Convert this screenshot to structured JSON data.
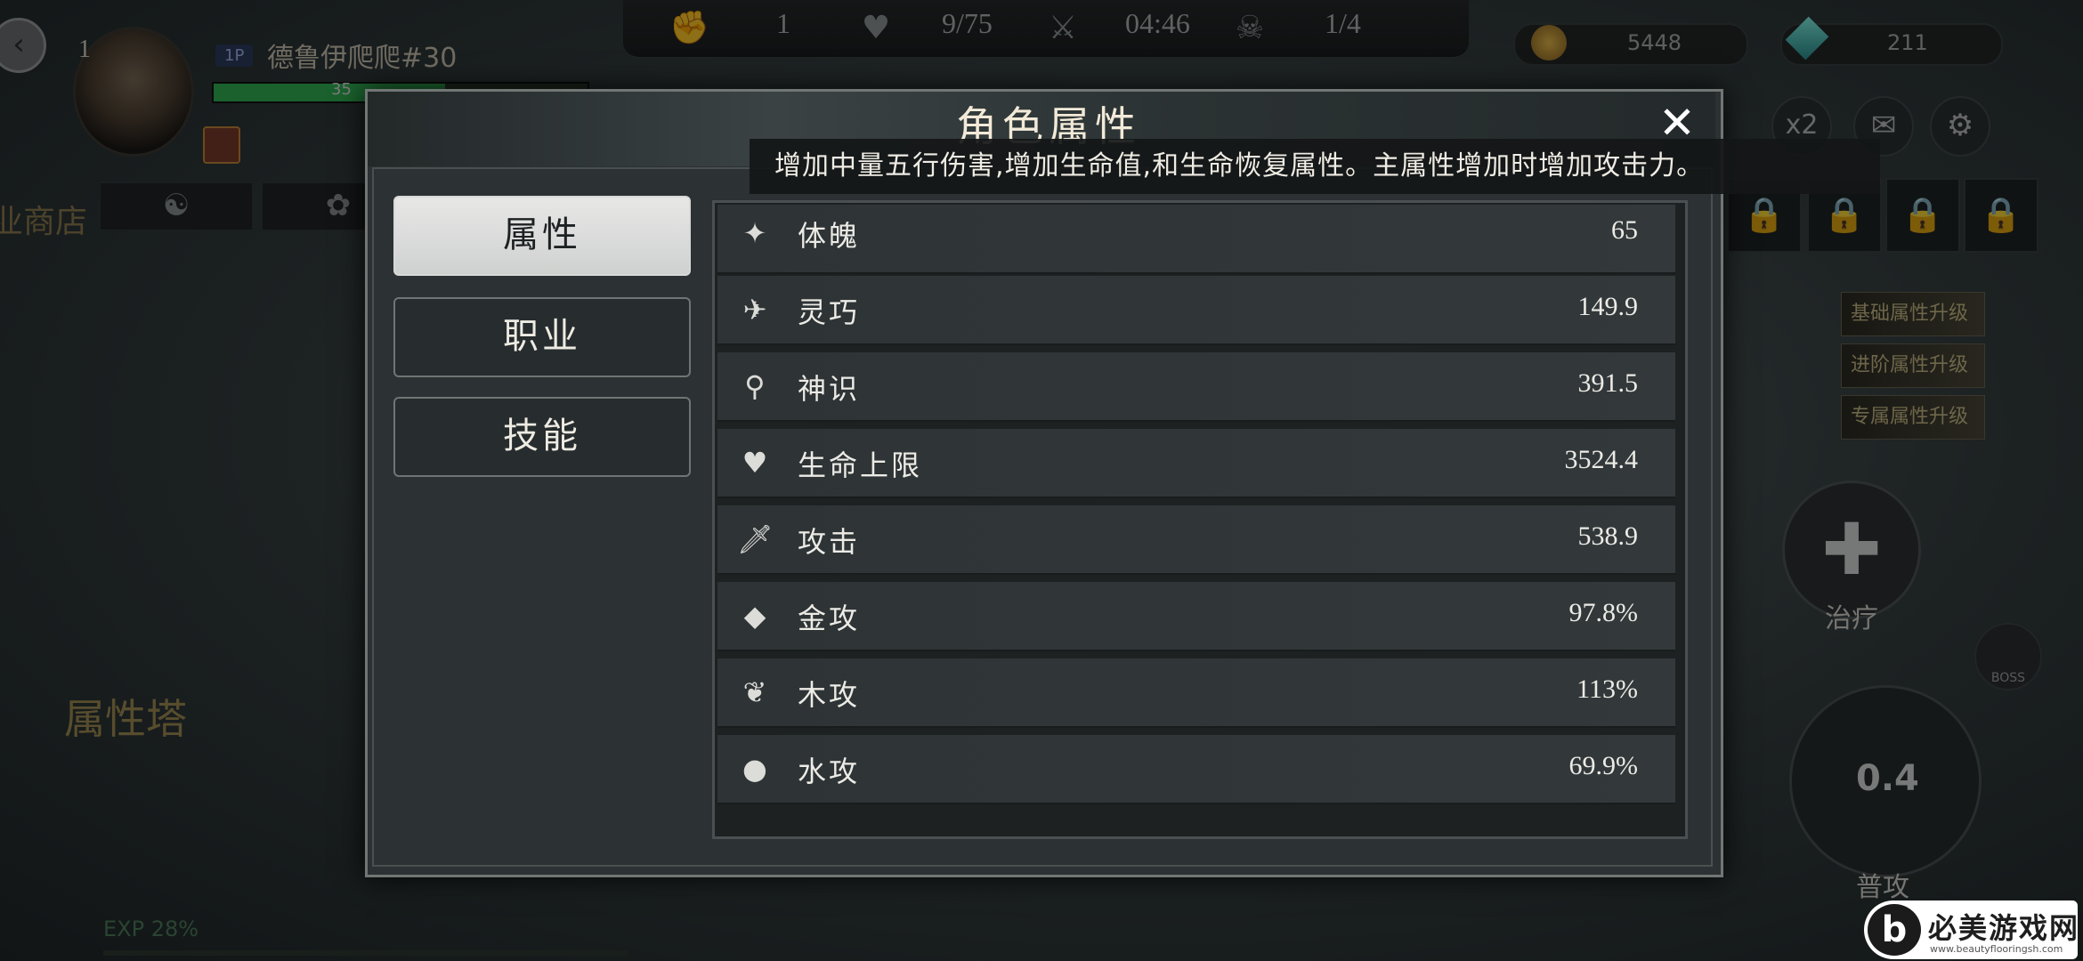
{
  "hud": {
    "back_glyph": "‹",
    "player_level": "1",
    "player_tag": "1P",
    "player_name": "德鲁伊爬爬#30",
    "hp_text": "35",
    "hp_fraction": 0.62,
    "stats": [
      {
        "icon": "fist-icon",
        "glyph": "✊",
        "value": "1"
      },
      {
        "icon": "heartbeat-icon",
        "glyph": "♥",
        "value": "9/75"
      },
      {
        "icon": "crossed-swords-icon",
        "glyph": "⚔",
        "value": "04:46"
      },
      {
        "icon": "demon-mask-icon",
        "glyph": "☠",
        "value": "1/4"
      }
    ],
    "coins": "5448",
    "gems": "211",
    "speed_label": "x2",
    "shop_label": "业商店",
    "tower_label": "属性塔",
    "side_tabs": [
      "基础属性升级",
      "进阶属性升级",
      "专属属性升级"
    ],
    "heal_label": "治疗",
    "attack_cooldown": "0.4",
    "attack_label": "普攻",
    "boss_label": "BOSS",
    "exp_label": "EXP 28%"
  },
  "watermark": {
    "logo": "b",
    "title": "必美游戏网",
    "url": "www.beautyflooringsh.com"
  },
  "dialog": {
    "title": "角色属性",
    "close_glyph": "✕",
    "tooltip": "增加中量五行伤害,增加生命值,和生命恢复属性。主属性增加时增加攻击力。",
    "tabs": [
      {
        "label": "属性",
        "active": true
      },
      {
        "label": "职业",
        "active": false
      },
      {
        "label": "技能",
        "active": false
      }
    ],
    "attributes": [
      {
        "icon": "physique-icon",
        "glyph": "✦",
        "label": "体魄",
        "value": "65"
      },
      {
        "icon": "agility-icon",
        "glyph": "✈",
        "label": "灵巧",
        "value": "149.9"
      },
      {
        "icon": "spirit-icon",
        "glyph": "⚲",
        "label": "神识",
        "value": "391.5"
      },
      {
        "icon": "heart-icon",
        "glyph": "♥",
        "label": "生命上限",
        "value": "3524.4"
      },
      {
        "icon": "sword-icon",
        "glyph": "🗡",
        "label": "攻击",
        "value": "538.9"
      },
      {
        "icon": "metal-icon",
        "glyph": "◆",
        "label": "金攻",
        "value": "97.8%"
      },
      {
        "icon": "leaf-icon",
        "glyph": "❦",
        "label": "木攻",
        "value": "113%"
      },
      {
        "icon": "water-drop-icon",
        "glyph": "●",
        "label": "水攻",
        "value": "69.9%"
      }
    ]
  }
}
